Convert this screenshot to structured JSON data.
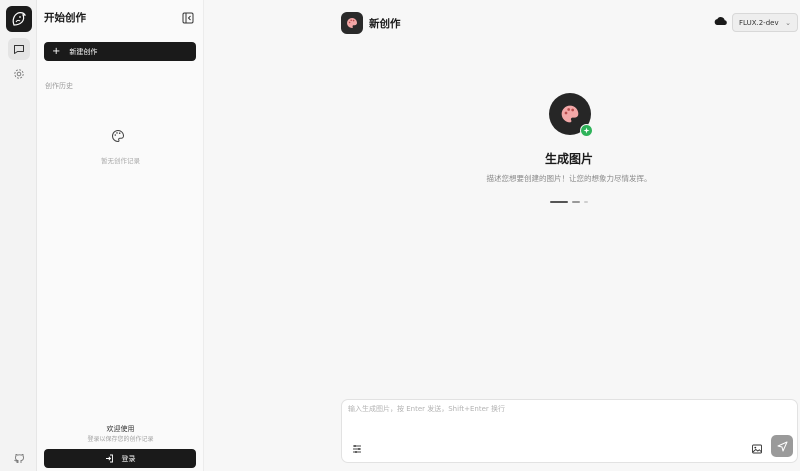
{
  "sidebar": {
    "title": "开始创作",
    "new_button": "新建创作",
    "history_label": "创作历史",
    "empty_text": "暂无创作记录",
    "welcome": "欢迎使用",
    "welcome_sub": "登录以保存您的创作记录",
    "login_button": "登录"
  },
  "header": {
    "title": "新创作",
    "model": "FLUX.2-dev"
  },
  "hero": {
    "title": "生成图片",
    "subtitle": "描述您想要创建的图片！让您的想象力尽情发挥。"
  },
  "composer": {
    "placeholder": "输入生成图片，按 Enter 发送，Shift+Enter 换行"
  },
  "icons": {
    "rail": [
      "logo-icon",
      "chat-icon",
      "settings-icon",
      "github-icon"
    ],
    "sidebar": [
      "collapse-icon",
      "plus-icon",
      "palette-icon",
      "login-icon"
    ],
    "composer": [
      "sliders-icon",
      "image-icon",
      "send-icon"
    ]
  },
  "colors": {
    "primary": "#1a1a1a",
    "badge": "#2fb35a",
    "send_disabled": "#9a9a9a",
    "avatar_palette": "#f2a7a7"
  }
}
